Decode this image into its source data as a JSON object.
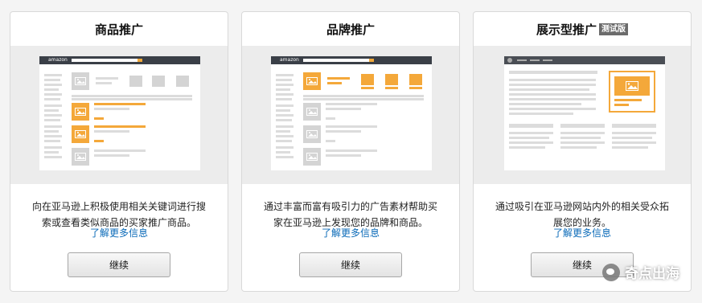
{
  "cards": [
    {
      "title": "商品推广",
      "badge": "",
      "desc_line1": "向在亚马逊上积极使用相关关键词进行搜",
      "desc_line2": "索或查看类似商品的买家推广商品。",
      "learn_more": "了解更多信息",
      "button": "继续"
    },
    {
      "title": "品牌推广",
      "badge": "",
      "desc_line1": "通过丰富而富有吸引力的广告素材帮助买",
      "desc_line2": "家在亚马逊上发现您的品牌和商品。",
      "learn_more": "了解更多信息",
      "button": "继续"
    },
    {
      "title": "展示型推广",
      "badge": "测试版",
      "desc_line1": "通过吸引在亚马逊网站内外的相关受众拓",
      "desc_line2": "展您的业务。",
      "learn_more": "了解更多信息",
      "button": "继续"
    }
  ],
  "mockup": {
    "logo_text": "amazon"
  },
  "watermark": {
    "text": "奇点出海"
  },
  "colors": {
    "accent_orange": "#f4a83a",
    "link_blue": "#0a6ab8",
    "mock_bar": "#3a3f47"
  }
}
